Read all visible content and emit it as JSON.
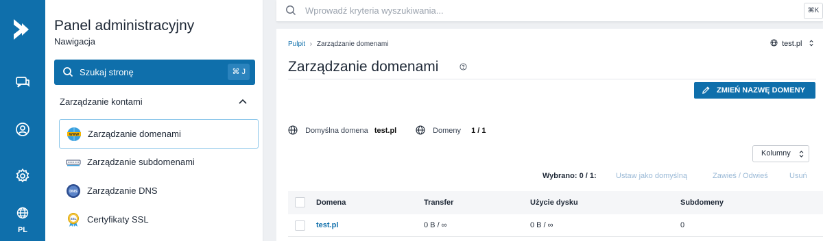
{
  "rail": {
    "lang": "PL",
    "icons": [
      "logo-icon",
      "chat-icon",
      "user-icon",
      "settings-icon",
      "globe-icon"
    ]
  },
  "panel": {
    "title": "Panel administracyjny",
    "subtitle": "Nawigacja",
    "search_label": "Szukaj stronę",
    "search_shortcut": "⌘ J",
    "section": "Zarządzanie kontami",
    "items": [
      {
        "label": "Zarządzanie domenami",
        "icon": "www-icon",
        "active": true
      },
      {
        "label": "Zarządzanie subdomenami",
        "icon": "subdomain-icon",
        "active": false
      },
      {
        "label": "Zarządzanie DNS",
        "icon": "dns-icon",
        "active": false
      },
      {
        "label": "Certyfikaty SSL",
        "icon": "ssl-icon",
        "active": false
      }
    ]
  },
  "topbar": {
    "placeholder": "Wprowadź kryteria wyszukiwania...",
    "shortcut": "⌘K"
  },
  "breadcrumb": {
    "root": "Pulpit",
    "separator": "›",
    "current": "Zarządzanie domenami"
  },
  "domain_select": "test.pl",
  "page_title": "Zarządzanie domenami",
  "rename_button": "ZMIEŃ NAZWĘ DOMENY",
  "info": {
    "default_domain_label": "Domyślna domena",
    "default_domain_value": "test.pl",
    "domains_label": "Domeny",
    "domains_value": "1 / 1"
  },
  "columns_button": "Kolumny",
  "bulk": {
    "selected": "Wybrano: 0 / 1:",
    "set_default": "Ustaw jako domyślną",
    "suspend": "Zawieś / Odwieś",
    "delete": "Usuń"
  },
  "table": {
    "headers": [
      "Domena",
      "Transfer",
      "Użycie dysku",
      "Subdomeny"
    ],
    "rows": [
      [
        "test.pl",
        "0 B / ∞",
        "0 B / ∞",
        "0"
      ]
    ]
  },
  "colors": {
    "primary": "#0f6fab",
    "muted_action": "#9ab9d6"
  }
}
